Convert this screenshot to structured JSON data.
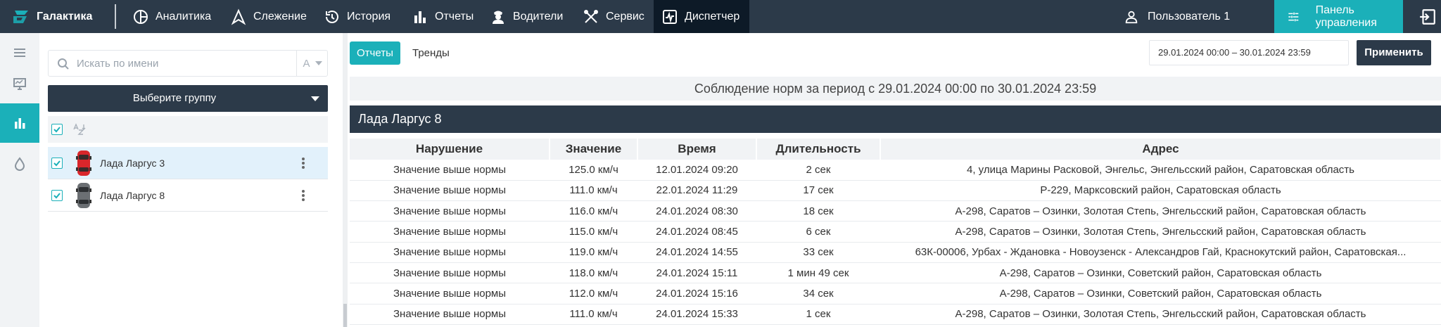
{
  "app": {
    "brand": "Галактика",
    "nav": [
      {
        "label": "Аналитика",
        "icon": "analytics-icon"
      },
      {
        "label": "Слежение",
        "icon": "tracking-icon"
      },
      {
        "label": "История",
        "icon": "history-icon"
      },
      {
        "label": "Отчеты",
        "icon": "reports-icon"
      },
      {
        "label": "Водители",
        "icon": "drivers-icon"
      },
      {
        "label": "Сервис",
        "icon": "service-icon"
      },
      {
        "label": "Диспетчер",
        "icon": "dispatcher-icon",
        "active": true
      }
    ],
    "user": "Пользователь 1",
    "control_panel": "Панель управления"
  },
  "colors": {
    "nav_bg": "#2c3a49",
    "accent": "#1bb0b9",
    "nav_active": "#0d1a27",
    "car_red": "#d9262b",
    "car_gray": "#6b6f73"
  },
  "rail": [
    {
      "icon": "menu-icon"
    },
    {
      "icon": "monitor-icon"
    },
    {
      "icon": "bar-chart-icon",
      "active": true
    },
    {
      "icon": "fuel-drop-icon"
    }
  ],
  "objects": {
    "search_placeholder": "Искать по имени",
    "sort_label": "А",
    "group_select": "Выберите группу",
    "items": [
      {
        "name": "Лада Ларгус 3",
        "color": "red",
        "checked": true,
        "selected": true
      },
      {
        "name": "Лада Ларгус 8",
        "color": "gray",
        "checked": true,
        "selected": false
      }
    ]
  },
  "main": {
    "tabs": [
      {
        "label": "Отчеты",
        "active": true
      },
      {
        "label": "Тренды",
        "active": false
      }
    ],
    "date_range": "29.01.2024 00:00 – 30.01.2024 23:59",
    "apply": "Применить",
    "report_title": "Соблюдение норм за период с 29.01.2024 00:00 по 30.01.2024 23:59",
    "object_name": "Лада Ларгус 8",
    "table": {
      "columns": [
        "Нарушение",
        "Значение",
        "Время",
        "Длительность",
        "Адрес"
      ],
      "rows": [
        [
          "Значение выше нормы",
          "125.0 км/ч",
          "12.01.2024 09:20",
          "2 сек",
          "4, улица Марины Расковой, Энгельс, Энгельсский район, Саратовская область"
        ],
        [
          "Значение выше нормы",
          "111.0 км/ч",
          "22.01.2024 11:29",
          "17 сек",
          "Р-229, Марксовский район, Саратовская область"
        ],
        [
          "Значение выше нормы",
          "116.0 км/ч",
          "24.01.2024 08:30",
          "18 сек",
          "А-298, Саратов – Озинки, Золотая Степь, Энгельсский район, Саратовская область"
        ],
        [
          "Значение выше нормы",
          "115.0 км/ч",
          "24.01.2024 08:45",
          "6 сек",
          "А-298, Саратов – Озинки, Золотая Степь, Энгельсский район, Саратовская область"
        ],
        [
          "Значение выше нормы",
          "119.0 км/ч",
          "24.01.2024 14:55",
          "33 сек",
          "63К-00006, Урбах - Ждановка - Новоузенск - Александров Гай, Краснокутский район, Саратовская..."
        ],
        [
          "Значение выше нормы",
          "118.0 км/ч",
          "24.01.2024 15:11",
          "1 мин 49 сек",
          "А-298, Саратов – Озинки, Советский район, Саратовская область"
        ],
        [
          "Значение выше нормы",
          "112.0 км/ч",
          "24.01.2024 15:16",
          "34 сек",
          "А-298, Саратов – Озинки, Советский район, Саратовская область"
        ],
        [
          "Значение выше нормы",
          "111.0 км/ч",
          "24.01.2024 15:33",
          "1 сек",
          "А-298, Саратов – Озинки, Золотая Степь, Энгельсский район, Саратовская область"
        ]
      ]
    }
  }
}
